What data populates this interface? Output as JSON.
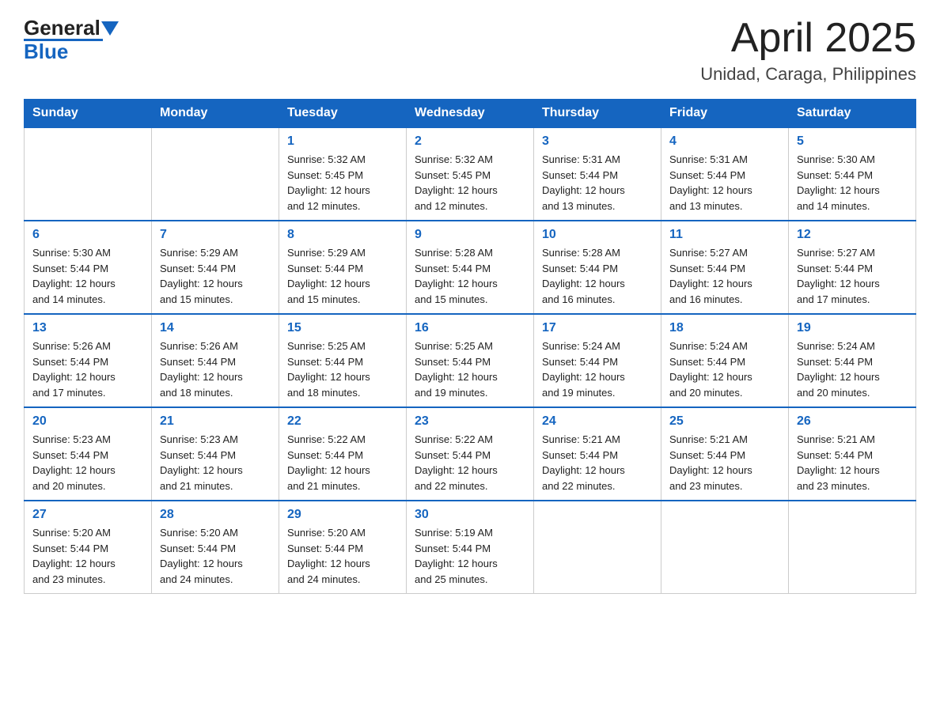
{
  "header": {
    "logo_general": "General",
    "logo_blue": "Blue",
    "month_year": "April 2025",
    "location": "Unidad, Caraga, Philippines"
  },
  "days_of_week": [
    "Sunday",
    "Monday",
    "Tuesday",
    "Wednesday",
    "Thursday",
    "Friday",
    "Saturday"
  ],
  "weeks": [
    [
      {
        "day": "",
        "info": ""
      },
      {
        "day": "",
        "info": ""
      },
      {
        "day": "1",
        "info": "Sunrise: 5:32 AM\nSunset: 5:45 PM\nDaylight: 12 hours\nand 12 minutes."
      },
      {
        "day": "2",
        "info": "Sunrise: 5:32 AM\nSunset: 5:45 PM\nDaylight: 12 hours\nand 12 minutes."
      },
      {
        "day": "3",
        "info": "Sunrise: 5:31 AM\nSunset: 5:44 PM\nDaylight: 12 hours\nand 13 minutes."
      },
      {
        "day": "4",
        "info": "Sunrise: 5:31 AM\nSunset: 5:44 PM\nDaylight: 12 hours\nand 13 minutes."
      },
      {
        "day": "5",
        "info": "Sunrise: 5:30 AM\nSunset: 5:44 PM\nDaylight: 12 hours\nand 14 minutes."
      }
    ],
    [
      {
        "day": "6",
        "info": "Sunrise: 5:30 AM\nSunset: 5:44 PM\nDaylight: 12 hours\nand 14 minutes."
      },
      {
        "day": "7",
        "info": "Sunrise: 5:29 AM\nSunset: 5:44 PM\nDaylight: 12 hours\nand 15 minutes."
      },
      {
        "day": "8",
        "info": "Sunrise: 5:29 AM\nSunset: 5:44 PM\nDaylight: 12 hours\nand 15 minutes."
      },
      {
        "day": "9",
        "info": "Sunrise: 5:28 AM\nSunset: 5:44 PM\nDaylight: 12 hours\nand 15 minutes."
      },
      {
        "day": "10",
        "info": "Sunrise: 5:28 AM\nSunset: 5:44 PM\nDaylight: 12 hours\nand 16 minutes."
      },
      {
        "day": "11",
        "info": "Sunrise: 5:27 AM\nSunset: 5:44 PM\nDaylight: 12 hours\nand 16 minutes."
      },
      {
        "day": "12",
        "info": "Sunrise: 5:27 AM\nSunset: 5:44 PM\nDaylight: 12 hours\nand 17 minutes."
      }
    ],
    [
      {
        "day": "13",
        "info": "Sunrise: 5:26 AM\nSunset: 5:44 PM\nDaylight: 12 hours\nand 17 minutes."
      },
      {
        "day": "14",
        "info": "Sunrise: 5:26 AM\nSunset: 5:44 PM\nDaylight: 12 hours\nand 18 minutes."
      },
      {
        "day": "15",
        "info": "Sunrise: 5:25 AM\nSunset: 5:44 PM\nDaylight: 12 hours\nand 18 minutes."
      },
      {
        "day": "16",
        "info": "Sunrise: 5:25 AM\nSunset: 5:44 PM\nDaylight: 12 hours\nand 19 minutes."
      },
      {
        "day": "17",
        "info": "Sunrise: 5:24 AM\nSunset: 5:44 PM\nDaylight: 12 hours\nand 19 minutes."
      },
      {
        "day": "18",
        "info": "Sunrise: 5:24 AM\nSunset: 5:44 PM\nDaylight: 12 hours\nand 20 minutes."
      },
      {
        "day": "19",
        "info": "Sunrise: 5:24 AM\nSunset: 5:44 PM\nDaylight: 12 hours\nand 20 minutes."
      }
    ],
    [
      {
        "day": "20",
        "info": "Sunrise: 5:23 AM\nSunset: 5:44 PM\nDaylight: 12 hours\nand 20 minutes."
      },
      {
        "day": "21",
        "info": "Sunrise: 5:23 AM\nSunset: 5:44 PM\nDaylight: 12 hours\nand 21 minutes."
      },
      {
        "day": "22",
        "info": "Sunrise: 5:22 AM\nSunset: 5:44 PM\nDaylight: 12 hours\nand 21 minutes."
      },
      {
        "day": "23",
        "info": "Sunrise: 5:22 AM\nSunset: 5:44 PM\nDaylight: 12 hours\nand 22 minutes."
      },
      {
        "day": "24",
        "info": "Sunrise: 5:21 AM\nSunset: 5:44 PM\nDaylight: 12 hours\nand 22 minutes."
      },
      {
        "day": "25",
        "info": "Sunrise: 5:21 AM\nSunset: 5:44 PM\nDaylight: 12 hours\nand 23 minutes."
      },
      {
        "day": "26",
        "info": "Sunrise: 5:21 AM\nSunset: 5:44 PM\nDaylight: 12 hours\nand 23 minutes."
      }
    ],
    [
      {
        "day": "27",
        "info": "Sunrise: 5:20 AM\nSunset: 5:44 PM\nDaylight: 12 hours\nand 23 minutes."
      },
      {
        "day": "28",
        "info": "Sunrise: 5:20 AM\nSunset: 5:44 PM\nDaylight: 12 hours\nand 24 minutes."
      },
      {
        "day": "29",
        "info": "Sunrise: 5:20 AM\nSunset: 5:44 PM\nDaylight: 12 hours\nand 24 minutes."
      },
      {
        "day": "30",
        "info": "Sunrise: 5:19 AM\nSunset: 5:44 PM\nDaylight: 12 hours\nand 25 minutes."
      },
      {
        "day": "",
        "info": ""
      },
      {
        "day": "",
        "info": ""
      },
      {
        "day": "",
        "info": ""
      }
    ]
  ]
}
